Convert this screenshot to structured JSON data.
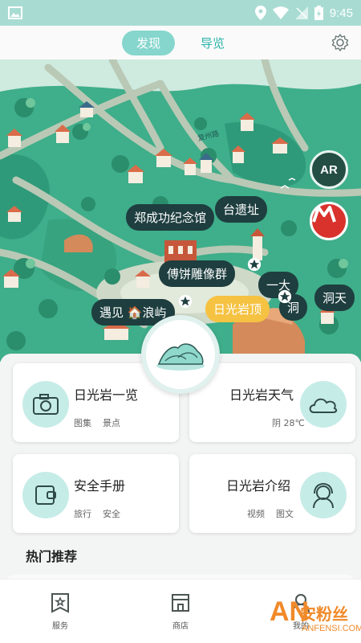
{
  "status_bar": {
    "time": "9:45"
  },
  "header": {
    "tabs": [
      {
        "label": "发现",
        "active": true
      },
      {
        "label": "导览",
        "active": false
      }
    ]
  },
  "map": {
    "road_label": "复州路",
    "ar_label": "AR",
    "bubbles": [
      {
        "label": "郑成功纪念馆"
      },
      {
        "label": "台遗址"
      },
      {
        "label": "傅饼雕像群"
      },
      {
        "label": "一大"
      },
      {
        "label": "洞天"
      },
      {
        "label": "遇见"
      },
      {
        "label": "浪屿"
      },
      {
        "label": "日光岩顶"
      },
      {
        "label": "洞"
      }
    ]
  },
  "cards": [
    {
      "title": "日光岩一览",
      "tags": [
        "图集",
        "景点"
      ],
      "icon": "camera-icon"
    },
    {
      "title": "日光岩天气",
      "tags": [
        "阴 28℃"
      ],
      "icon": "cloud-icon"
    },
    {
      "title": "安全手册",
      "tags": [
        "旅行",
        "安全"
      ],
      "icon": "wallet-icon"
    },
    {
      "title": "日光岩介绍",
      "tags": [
        "视频",
        "图文"
      ],
      "icon": "headset-guide-icon"
    }
  ],
  "section": {
    "title": "热门推荐"
  },
  "bottom_nav": [
    {
      "label": "服务",
      "icon": "star-page-icon"
    },
    {
      "label": "商店",
      "icon": "shop-icon"
    },
    {
      "label": "我的",
      "icon": "user-icon"
    }
  ],
  "watermark": {
    "main": "安粉丝",
    "sub": "ANFENSI.COM",
    "letters": "AN"
  },
  "colors": {
    "accent": "#86d6cd",
    "map_green": "#3fae8a",
    "bubble_dark": "#1e3e3f",
    "metro_red": "#d9322c"
  }
}
